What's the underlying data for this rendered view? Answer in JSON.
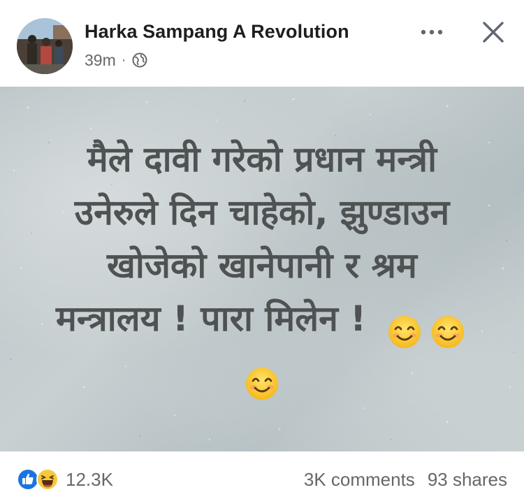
{
  "post": {
    "author": "Harka Sampang A Revolution",
    "time": "39m",
    "separator": "·",
    "audience_icon": "globe-icon",
    "more_icon": "more-icon",
    "close_icon": "close-icon",
    "text_lines": [
      "मैले दावी गरेको प्रधान मन्त्री",
      "उनेरुले दिन चाहेको,  झुण्डाउन",
      "खोजेको खानेपानी र श्रम",
      "मन्त्रालय ! पारा मिलेन !"
    ],
    "emoji": "smiling-face-icon",
    "background_color": "#bfc8cb",
    "text_color": "#4f5253"
  },
  "footer": {
    "reaction_icons": [
      "like-icon",
      "haha-icon"
    ],
    "reaction_count": "12.3K",
    "comments": "3K comments",
    "shares": "93 shares"
  }
}
